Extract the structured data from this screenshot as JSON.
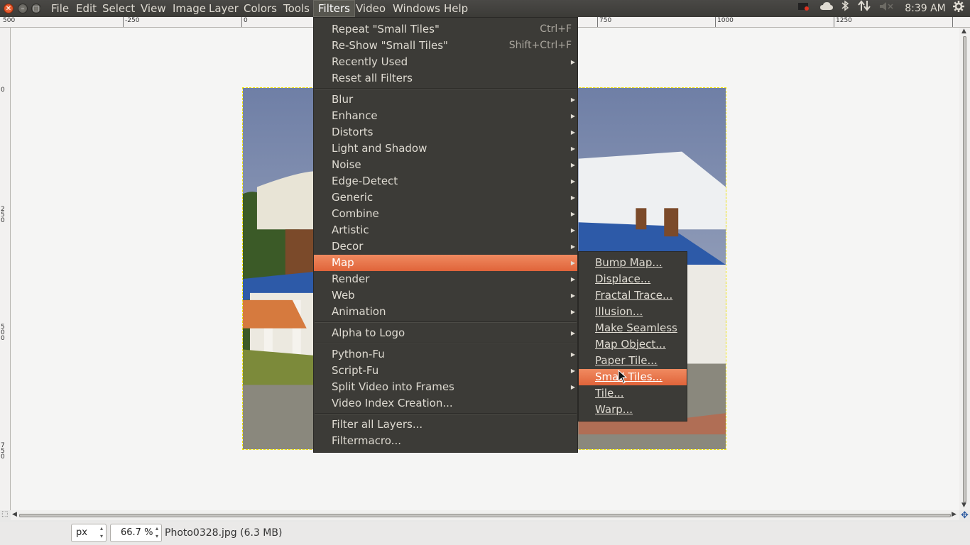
{
  "menubar": {
    "items": [
      "File",
      "Edit",
      "Select",
      "View",
      "Image",
      "Layer",
      "Colors",
      "Tools",
      "Filters",
      "Video",
      "Windows",
      "Help"
    ],
    "active": "Filters"
  },
  "tray": {
    "clock": "8:39 AM"
  },
  "ruler": {
    "top_labels": [
      "500",
      "-250",
      "0",
      "750",
      "1000",
      "1250"
    ],
    "left_labels": [
      "0",
      "250",
      "500",
      "750"
    ]
  },
  "filters_menu": {
    "groups": [
      [
        {
          "label": "Repeat \"Small Tiles\"",
          "accel": "Ctrl+F"
        },
        {
          "label": "Re-Show \"Small Tiles\"",
          "accel": "Shift+Ctrl+F"
        },
        {
          "label": "Recently Used",
          "submenu": true
        },
        {
          "label": "Reset all Filters"
        }
      ],
      [
        {
          "label": "Blur",
          "submenu": true
        },
        {
          "label": "Enhance",
          "submenu": true
        },
        {
          "label": "Distorts",
          "submenu": true
        },
        {
          "label": "Light and Shadow",
          "submenu": true
        },
        {
          "label": "Noise",
          "submenu": true
        },
        {
          "label": "Edge-Detect",
          "submenu": true
        },
        {
          "label": "Generic",
          "submenu": true
        },
        {
          "label": "Combine",
          "submenu": true
        },
        {
          "label": "Artistic",
          "submenu": true
        },
        {
          "label": "Decor",
          "submenu": true
        },
        {
          "label": "Map",
          "submenu": true,
          "highlighted": true
        },
        {
          "label": "Render",
          "submenu": true
        },
        {
          "label": "Web",
          "submenu": true
        },
        {
          "label": "Animation",
          "submenu": true
        }
      ],
      [
        {
          "label": "Alpha to Logo",
          "submenu": true
        }
      ],
      [
        {
          "label": "Python-Fu",
          "submenu": true
        },
        {
          "label": "Script-Fu",
          "submenu": true
        },
        {
          "label": "Split Video into Frames",
          "submenu": true
        },
        {
          "label": "Video Index Creation..."
        }
      ],
      [
        {
          "label": "Filter all Layers..."
        },
        {
          "label": "Filtermacro..."
        }
      ]
    ]
  },
  "map_menu": {
    "items": [
      {
        "label": "Bump Map..."
      },
      {
        "label": "Displace..."
      },
      {
        "label": "Fractal Trace..."
      },
      {
        "label": "Illusion..."
      },
      {
        "label": "Make Seamless"
      },
      {
        "label": "Map Object..."
      },
      {
        "label": "Paper Tile..."
      },
      {
        "label": "Small Tiles...",
        "highlighted": true
      },
      {
        "label": "Tile..."
      },
      {
        "label": "Warp..."
      }
    ]
  },
  "statusbar": {
    "unit": "px",
    "zoom": "66.7 %",
    "file_info": "Photo0328.jpg (6.3 MB)"
  },
  "colors": {
    "menu_bg": "#3c3b37",
    "highlight": "#e9683e",
    "panel_bg": "#3c3b37"
  }
}
